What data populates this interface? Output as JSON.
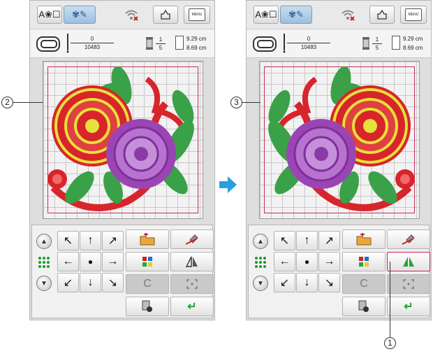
{
  "callouts": {
    "left": "2",
    "right": "3",
    "bottom": "1"
  },
  "colors": {
    "accent": "#2a9fe0",
    "frame": "#c2305a",
    "highlight": "#d41e4b",
    "enter_green": "#2aa33a"
  },
  "top_buttons": {
    "text_glyphs": "A❀☐",
    "embroidery_glyphs": "✾✎",
    "menu_label": "MENU",
    "icons": [
      "font-mode-icon",
      "embroidery-edit-icon",
      "wireless-off-icon",
      "move-icon",
      "menu-icon"
    ]
  },
  "left_screen": {
    "stitch_current": "0",
    "stitch_total": "10483",
    "color_index": "1",
    "color_total": "5",
    "width": "9.29 cm",
    "height": "8.69 cm"
  },
  "right_screen": {
    "stitch_current": "0",
    "stitch_total": "10483",
    "color_index": "1",
    "color_total": "5",
    "width": "9.29 cm",
    "height": "8.69 cm"
  },
  "controls": {
    "arrows": [
      "↖",
      "↑",
      "↗",
      "←",
      "●",
      "→",
      "↙",
      "↓",
      "↘"
    ],
    "enter_glyph": "↵",
    "rotate_glyph": "C",
    "icons": [
      "scroll-up-icon",
      "grid-icon",
      "scroll-down-icon",
      "open-file-icon",
      "delete-icon",
      "color-palette-icon",
      "mirror-icon",
      "rotate-icon",
      "resize-icon",
      "settings-icon",
      "enter-icon"
    ]
  }
}
